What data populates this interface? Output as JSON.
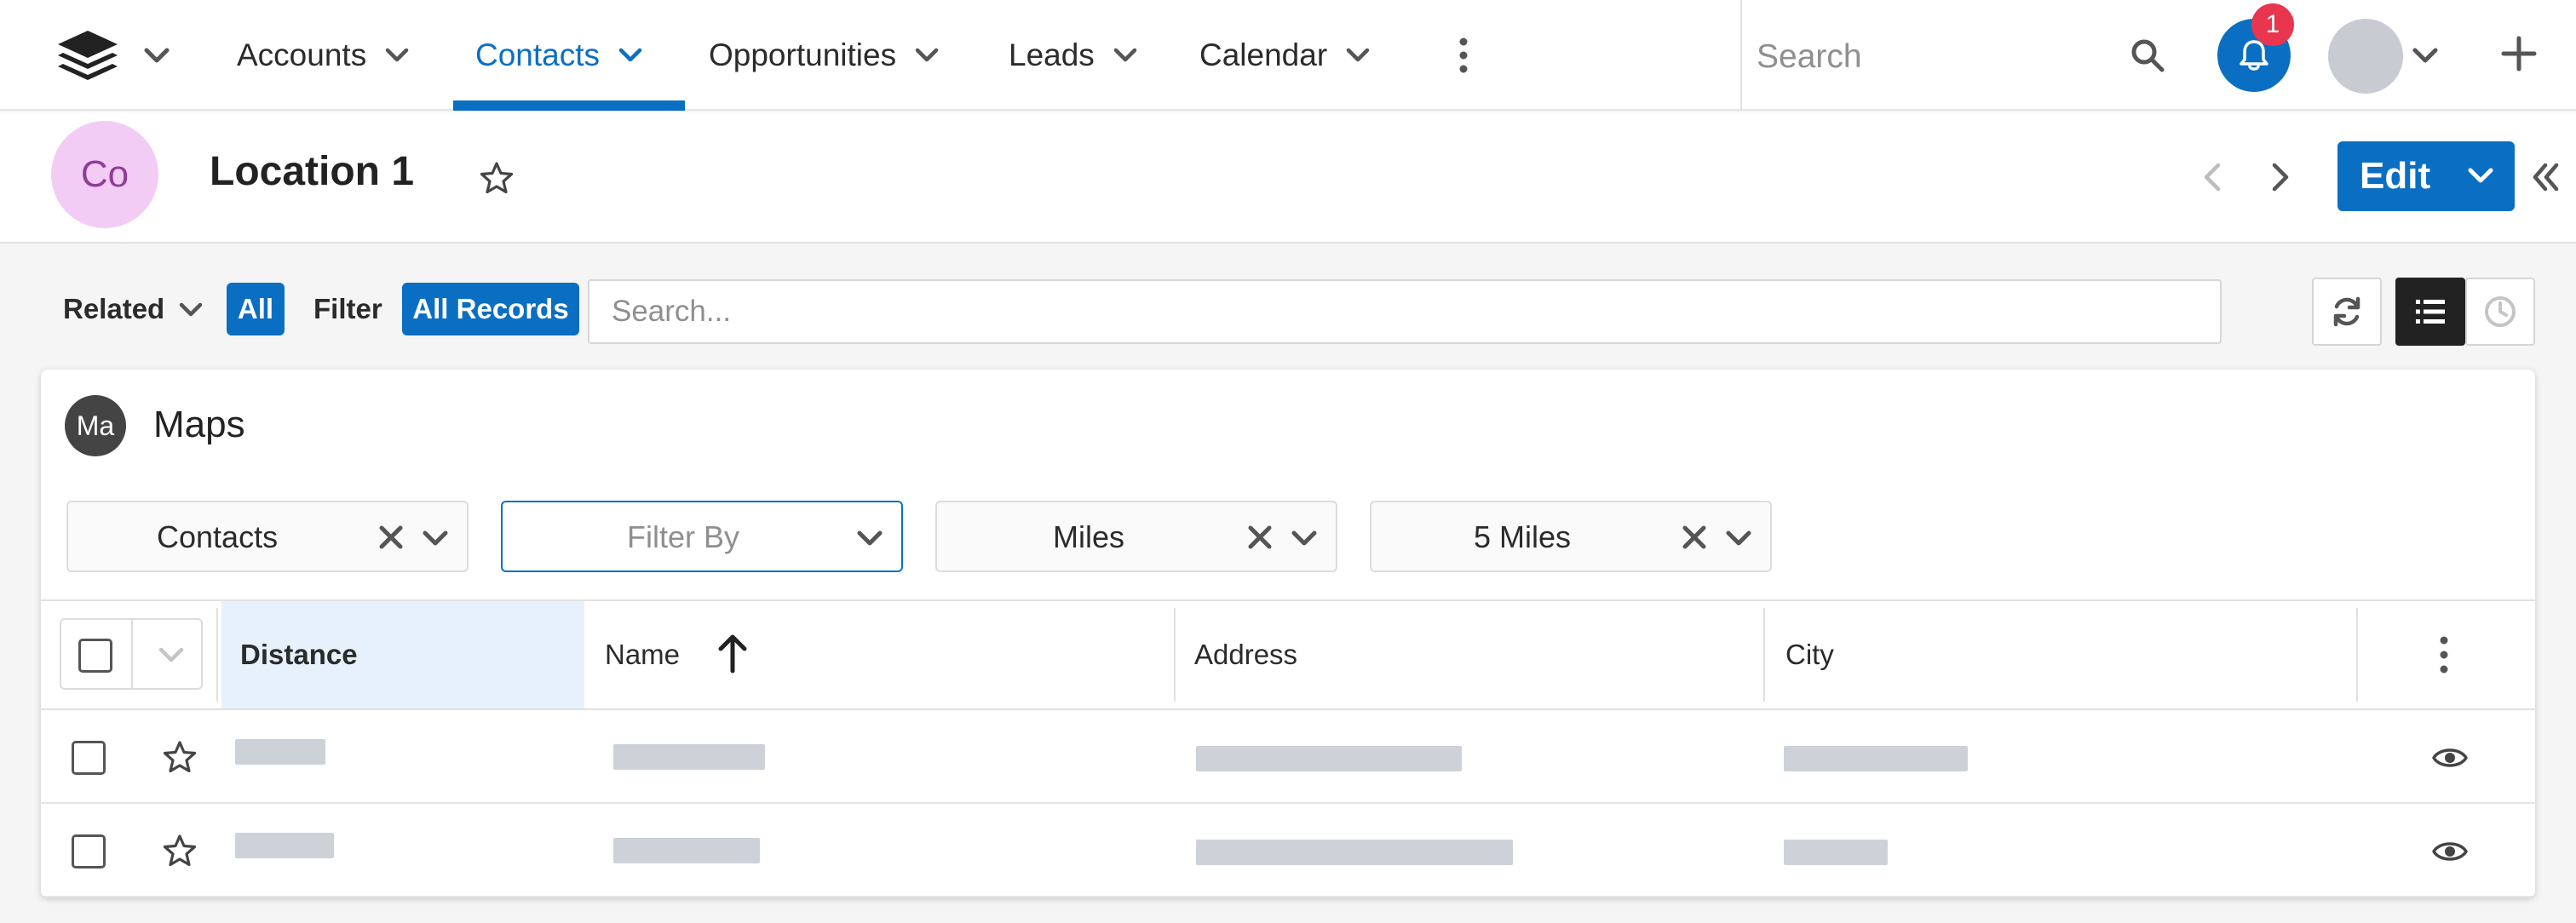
{
  "nav": {
    "items": [
      {
        "label": "Accounts",
        "active": false
      },
      {
        "label": "Contacts",
        "active": true
      },
      {
        "label": "Opportunities",
        "active": false
      },
      {
        "label": "Leads",
        "active": false
      },
      {
        "label": "Calendar",
        "active": false
      }
    ],
    "search_placeholder": "Search",
    "notification_count": "1",
    "accent_color": "#0a6fc2",
    "badge_color": "#e8364f"
  },
  "record": {
    "avatar_initials": "Co",
    "title": "Location 1",
    "edit_label": "Edit"
  },
  "filterbar": {
    "related_label": "Related",
    "related_value": "All",
    "filter_label": "Filter",
    "filter_value": "All Records",
    "search_placeholder": "Search..."
  },
  "card": {
    "avatar_initials": "Ma",
    "title": "Maps",
    "selects": [
      {
        "value": "Contacts",
        "clearable": true
      },
      {
        "value": "Filter By",
        "clearable": false,
        "placeholder": true
      },
      {
        "value": "Miles",
        "clearable": true
      },
      {
        "value": "5 Miles",
        "clearable": true
      }
    ]
  },
  "table": {
    "columns": [
      "Distance",
      "Name",
      "Address",
      "City"
    ],
    "sorted_column": "Distance",
    "sort_direction": "ascending",
    "rows": [
      {
        "distance": "",
        "name": "",
        "address": "",
        "city": "",
        "loading": true
      },
      {
        "distance": "",
        "name": "",
        "address": "",
        "city": "",
        "loading": true
      }
    ]
  },
  "icons": {
    "logo": "stacked-layers-icon",
    "search": "search-icon",
    "notifications": "bell-icon",
    "add": "plus-icon",
    "favorite": "star-icon",
    "refresh": "refresh-icon",
    "list_view": "list-icon",
    "timeline_view": "clock-icon",
    "view_record": "eye-icon"
  }
}
